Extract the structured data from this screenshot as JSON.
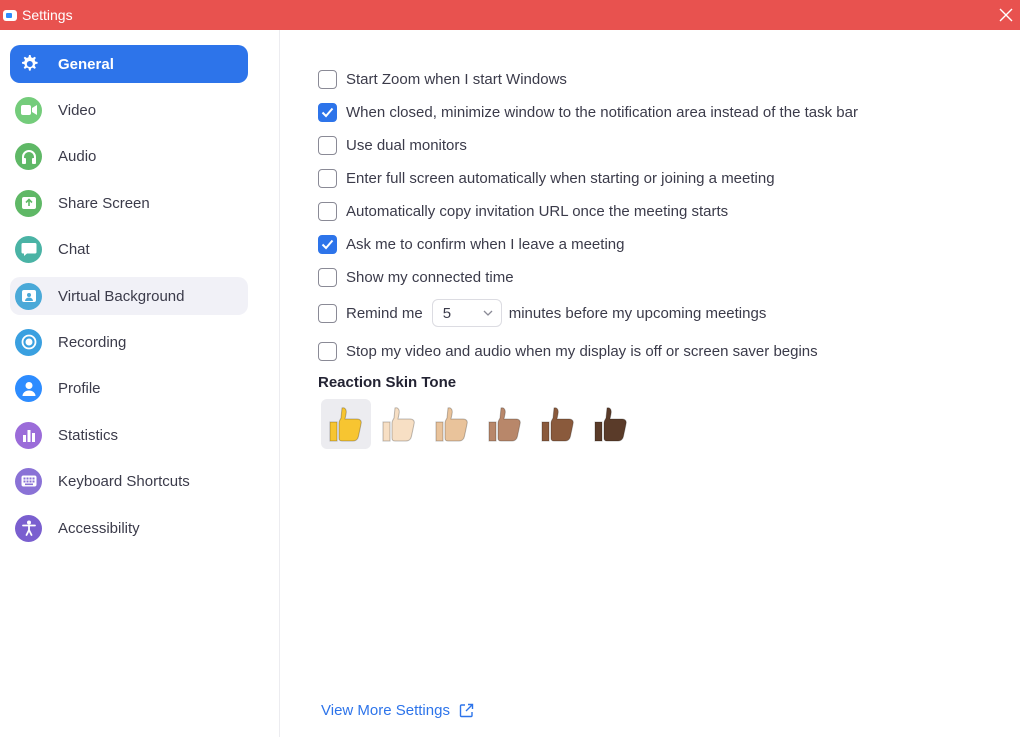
{
  "window": {
    "title": "Settings"
  },
  "sidebar": {
    "items": [
      {
        "label": "General",
        "icon": "gear-icon",
        "color": "#2d74ea"
      },
      {
        "label": "Video",
        "icon": "video-camera-icon",
        "color": "#74cc7b"
      },
      {
        "label": "Audio",
        "icon": "headphones-icon",
        "color": "#5fb866"
      },
      {
        "label": "Share Screen",
        "icon": "share-screen-icon",
        "color": "#5fb866"
      },
      {
        "label": "Chat",
        "icon": "chat-bubble-icon",
        "color": "#4ab3a5"
      },
      {
        "label": "Virtual Background",
        "icon": "person-frame-icon",
        "color": "#4aa9d8"
      },
      {
        "label": "Recording",
        "icon": "record-icon",
        "color": "#3aa0e0"
      },
      {
        "label": "Profile",
        "icon": "profile-icon",
        "color": "#2d8cff"
      },
      {
        "label": "Statistics",
        "icon": "bar-chart-icon",
        "color": "#9b6cd9"
      },
      {
        "label": "Keyboard Shortcuts",
        "icon": "keyboard-icon",
        "color": "#8a72d6"
      },
      {
        "label": "Accessibility",
        "icon": "accessibility-icon",
        "color": "#7a5fcf"
      }
    ]
  },
  "general": {
    "options": [
      {
        "label": "Start Zoom when I start Windows",
        "checked": false
      },
      {
        "label": "When closed, minimize window to the notification area instead of the task bar",
        "checked": true
      },
      {
        "label": "Use dual monitors",
        "checked": false
      },
      {
        "label": "Enter full screen automatically when starting or joining a meeting",
        "checked": false
      },
      {
        "label": "Automatically copy invitation URL once the meeting starts",
        "checked": false
      },
      {
        "label": "Ask me to confirm when I leave a meeting",
        "checked": true
      },
      {
        "label": "Show my connected time",
        "checked": false
      }
    ],
    "remind": {
      "label_before": "Remind me",
      "minutes_value": "5",
      "label_after": "minutes before my upcoming meetings",
      "checked": false
    },
    "stop_video": {
      "label": "Stop my video and audio when my display is off or screen saver begins",
      "checked": false
    },
    "reaction_skin_tone": {
      "title": "Reaction Skin Tone",
      "selected": 0,
      "tones": [
        "#f7c531",
        "#f7dfc4",
        "#e9c39b",
        "#b8876a",
        "#8a5a3c",
        "#5a3b29"
      ]
    },
    "view_more": "View More Settings"
  },
  "colors": {
    "accent": "#2d74ea",
    "titlebar": "#e8524f"
  }
}
